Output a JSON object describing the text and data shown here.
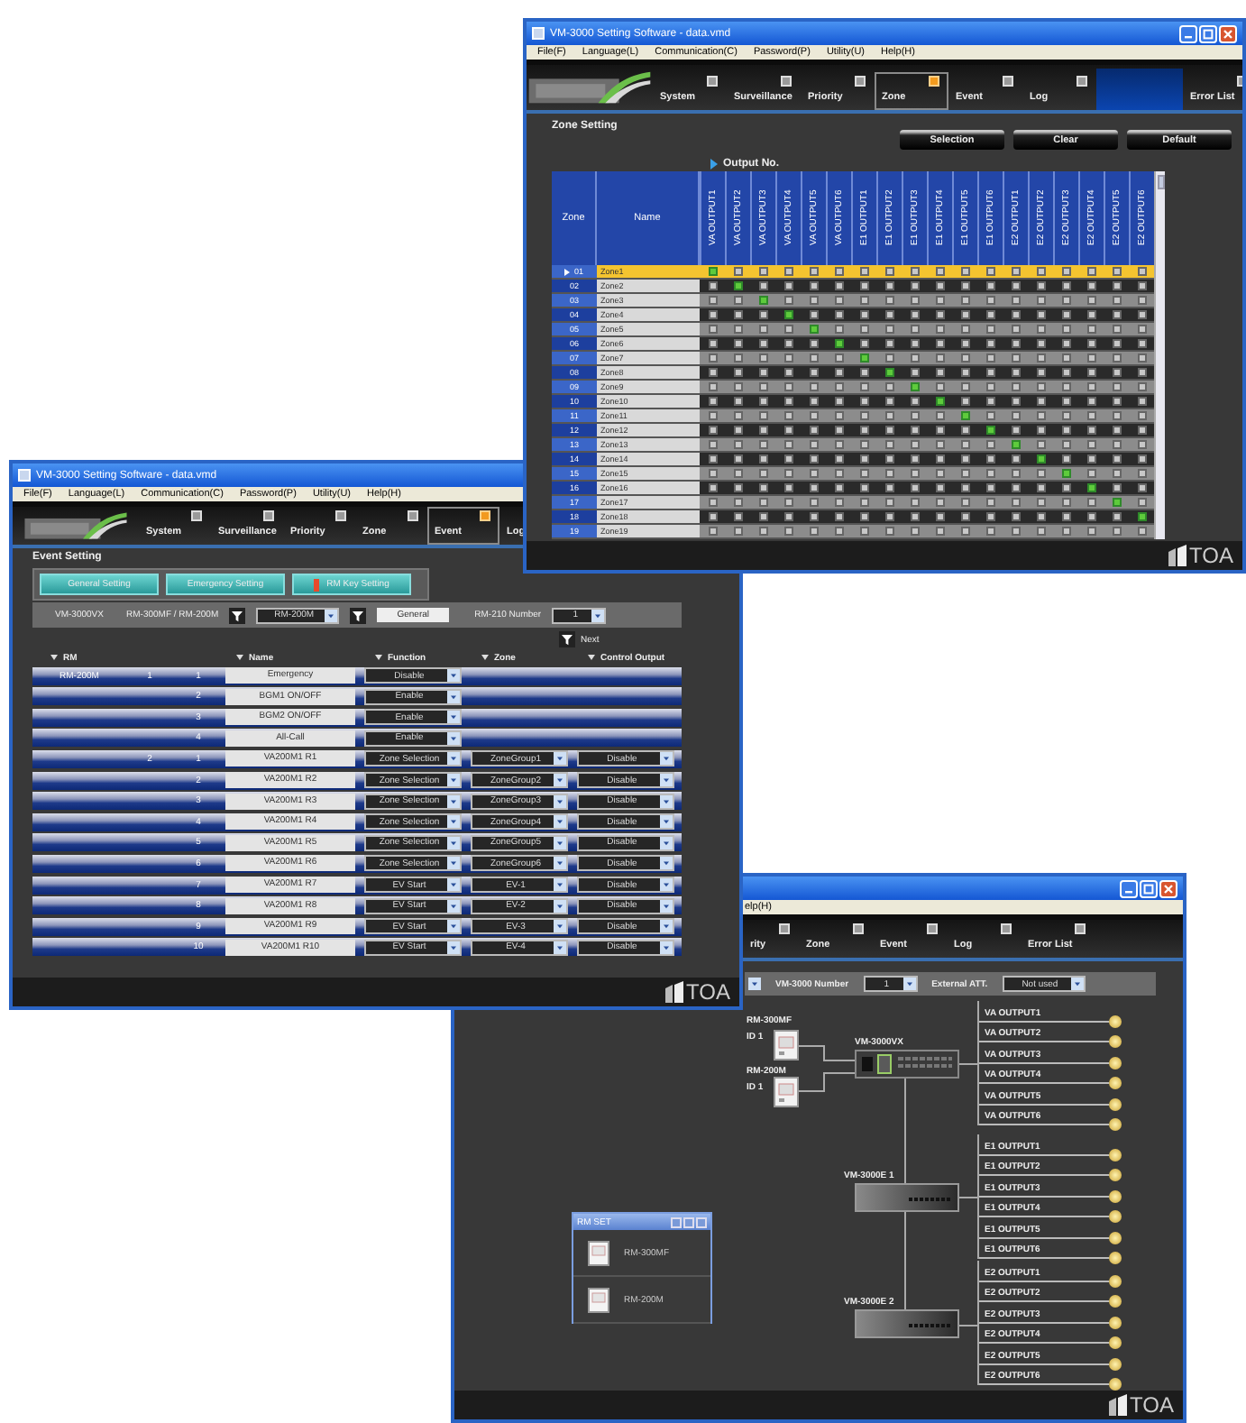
{
  "zone_window": {
    "title": "VM-3000 Setting Software - data.vmd",
    "menu": [
      "File(F)",
      "Language(L)",
      "Communication(C)",
      "Password(P)",
      "Utility(U)",
      "Help(H)"
    ],
    "tabs": [
      {
        "label": "System",
        "selected": false
      },
      {
        "label": "Surveillance",
        "selected": false
      },
      {
        "label": "Priority",
        "selected": false
      },
      {
        "label": "Zone",
        "selected": true
      },
      {
        "label": "Event",
        "selected": false
      },
      {
        "label": "Log",
        "selected": false
      },
      {
        "label": "Error List",
        "selected": false
      }
    ],
    "heading": "Zone Setting",
    "buttons": [
      "Selection",
      "Clear",
      "Default"
    ],
    "output_label": "Output No.",
    "columns": [
      "Zone",
      "Name"
    ],
    "outputs": [
      "VA OUTPUT1",
      "VA OUTPUT2",
      "VA OUTPUT3",
      "VA OUTPUT4",
      "VA OUTPUT5",
      "VA OUTPUT6",
      "E1 OUTPUT1",
      "E1 OUTPUT2",
      "E1 OUTPUT3",
      "E1 OUTPUT4",
      "E1 OUTPUT5",
      "E1 OUTPUT6",
      "E2 OUTPUT1",
      "E2 OUTPUT2",
      "E2 OUTPUT3",
      "E2 OUTPUT4",
      "E2 OUTPUT5",
      "E2 OUTPUT6"
    ],
    "rows": [
      {
        "zone": "01",
        "name": "Zone1",
        "selected": true,
        "outputs": [
          true,
          false,
          false,
          false,
          false,
          false,
          false,
          false,
          false,
          false,
          false,
          false,
          false,
          false,
          false,
          false,
          false,
          false
        ]
      },
      {
        "zone": "02",
        "name": "Zone2",
        "selected": false,
        "outputs": [
          false,
          true,
          false,
          false,
          false,
          false,
          false,
          false,
          false,
          false,
          false,
          false,
          false,
          false,
          false,
          false,
          false,
          false
        ]
      },
      {
        "zone": "03",
        "name": "Zone3",
        "selected": false,
        "outputs": [
          false,
          false,
          true,
          false,
          false,
          false,
          false,
          false,
          false,
          false,
          false,
          false,
          false,
          false,
          false,
          false,
          false,
          false
        ]
      },
      {
        "zone": "04",
        "name": "Zone4",
        "selected": false,
        "outputs": [
          false,
          false,
          false,
          true,
          false,
          false,
          false,
          false,
          false,
          false,
          false,
          false,
          false,
          false,
          false,
          false,
          false,
          false
        ]
      },
      {
        "zone": "05",
        "name": "Zone5",
        "selected": false,
        "outputs": [
          false,
          false,
          false,
          false,
          true,
          false,
          false,
          false,
          false,
          false,
          false,
          false,
          false,
          false,
          false,
          false,
          false,
          false
        ]
      },
      {
        "zone": "06",
        "name": "Zone6",
        "selected": false,
        "outputs": [
          false,
          false,
          false,
          false,
          false,
          true,
          false,
          false,
          false,
          false,
          false,
          false,
          false,
          false,
          false,
          false,
          false,
          false
        ]
      },
      {
        "zone": "07",
        "name": "Zone7",
        "selected": false,
        "outputs": [
          false,
          false,
          false,
          false,
          false,
          false,
          true,
          false,
          false,
          false,
          false,
          false,
          false,
          false,
          false,
          false,
          false,
          false
        ]
      },
      {
        "zone": "08",
        "name": "Zone8",
        "selected": false,
        "outputs": [
          false,
          false,
          false,
          false,
          false,
          false,
          false,
          true,
          false,
          false,
          false,
          false,
          false,
          false,
          false,
          false,
          false,
          false
        ]
      },
      {
        "zone": "09",
        "name": "Zone9",
        "selected": false,
        "outputs": [
          false,
          false,
          false,
          false,
          false,
          false,
          false,
          false,
          true,
          false,
          false,
          false,
          false,
          false,
          false,
          false,
          false,
          false
        ]
      },
      {
        "zone": "10",
        "name": "Zone10",
        "selected": false,
        "outputs": [
          false,
          false,
          false,
          false,
          false,
          false,
          false,
          false,
          false,
          true,
          false,
          false,
          false,
          false,
          false,
          false,
          false,
          false
        ]
      },
      {
        "zone": "11",
        "name": "Zone11",
        "selected": false,
        "outputs": [
          false,
          false,
          false,
          false,
          false,
          false,
          false,
          false,
          false,
          false,
          true,
          false,
          false,
          false,
          false,
          false,
          false,
          false
        ]
      },
      {
        "zone": "12",
        "name": "Zone12",
        "selected": false,
        "outputs": [
          false,
          false,
          false,
          false,
          false,
          false,
          false,
          false,
          false,
          false,
          false,
          true,
          false,
          false,
          false,
          false,
          false,
          false
        ]
      },
      {
        "zone": "13",
        "name": "Zone13",
        "selected": false,
        "outputs": [
          false,
          false,
          false,
          false,
          false,
          false,
          false,
          false,
          false,
          false,
          false,
          false,
          true,
          false,
          false,
          false,
          false,
          false
        ]
      },
      {
        "zone": "14",
        "name": "Zone14",
        "selected": false,
        "outputs": [
          false,
          false,
          false,
          false,
          false,
          false,
          false,
          false,
          false,
          false,
          false,
          false,
          false,
          true,
          false,
          false,
          false,
          false
        ]
      },
      {
        "zone": "15",
        "name": "Zone15",
        "selected": false,
        "outputs": [
          false,
          false,
          false,
          false,
          false,
          false,
          false,
          false,
          false,
          false,
          false,
          false,
          false,
          false,
          true,
          false,
          false,
          false
        ]
      },
      {
        "zone": "16",
        "name": "Zone16",
        "selected": false,
        "outputs": [
          false,
          false,
          false,
          false,
          false,
          false,
          false,
          false,
          false,
          false,
          false,
          false,
          false,
          false,
          false,
          true,
          false,
          false
        ]
      },
      {
        "zone": "17",
        "name": "Zone17",
        "selected": false,
        "outputs": [
          false,
          false,
          false,
          false,
          false,
          false,
          false,
          false,
          false,
          false,
          false,
          false,
          false,
          false,
          false,
          false,
          true,
          false
        ]
      },
      {
        "zone": "18",
        "name": "Zone18",
        "selected": false,
        "outputs": [
          false,
          false,
          false,
          false,
          false,
          false,
          false,
          false,
          false,
          false,
          false,
          false,
          false,
          false,
          false,
          false,
          false,
          true
        ]
      },
      {
        "zone": "19",
        "name": "Zone19",
        "selected": false,
        "outputs": [
          false,
          false,
          false,
          false,
          false,
          false,
          false,
          false,
          false,
          false,
          false,
          false,
          false,
          false,
          false,
          false,
          false,
          false
        ]
      }
    ],
    "brand": "TOA"
  },
  "event_window": {
    "title": "VM-3000 Setting Software - data.vmd",
    "menu": [
      "File(F)",
      "Language(L)",
      "Communication(C)",
      "Password(P)",
      "Utility(U)",
      "Help(H)"
    ],
    "tabs": [
      {
        "label": "System",
        "selected": false
      },
      {
        "label": "Surveillance",
        "selected": false
      },
      {
        "label": "Priority",
        "selected": false
      },
      {
        "label": "Zone",
        "selected": false
      },
      {
        "label": "Event",
        "selected": true
      },
      {
        "label": "Log",
        "selected": false
      }
    ],
    "heading": "Event Setting",
    "setting_buttons": [
      {
        "label": "General Setting",
        "selected": false
      },
      {
        "label": "Emergency Setting",
        "selected": false
      },
      {
        "label": "RM Key Setting",
        "selected": true
      }
    ],
    "filter": {
      "unit": "VM-3000VX",
      "device": "RM-300MF / RM-200M",
      "device_select": "RM-200M",
      "mode": "General",
      "number_label": "RM-210 Number",
      "number_select": "1"
    },
    "next": "Next",
    "columns": [
      "RM",
      "Name",
      "Function",
      "Zone",
      "Control Output"
    ],
    "rows": [
      {
        "rm": "RM-200M",
        "unit": "1",
        "key": "1",
        "name": "Emergency",
        "function": "Disable"
      },
      {
        "key": "2",
        "name": "BGM1 ON/OFF",
        "function": "Enable"
      },
      {
        "key": "3",
        "name": "BGM2 ON/OFF",
        "function": "Enable"
      },
      {
        "key": "4",
        "name": "All-Call",
        "function": "Enable"
      },
      {
        "unit": "2",
        "key": "1",
        "name": "VA200M1 R1",
        "function": "Zone Selection",
        "zone": "ZoneGroup1",
        "control_output": "Disable"
      },
      {
        "key": "2",
        "name": "VA200M1 R2",
        "function": "Zone Selection",
        "zone": "ZoneGroup2",
        "control_output": "Disable"
      },
      {
        "key": "3",
        "name": "VA200M1 R3",
        "function": "Zone Selection",
        "zone": "ZoneGroup3",
        "control_output": "Disable"
      },
      {
        "key": "4",
        "name": "VA200M1 R4",
        "function": "Zone Selection",
        "zone": "ZoneGroup4",
        "control_output": "Disable"
      },
      {
        "key": "5",
        "name": "VA200M1 R5",
        "function": "Zone Selection",
        "zone": "ZoneGroup5",
        "control_output": "Disable"
      },
      {
        "key": "6",
        "name": "VA200M1 R6",
        "function": "Zone Selection",
        "zone": "ZoneGroup6",
        "control_output": "Disable"
      },
      {
        "key": "7",
        "name": "VA200M1 R7",
        "function": "EV Start",
        "zone": "EV-1",
        "control_output": "Disable"
      },
      {
        "key": "8",
        "name": "VA200M1 R8",
        "function": "EV Start",
        "zone": "EV-2",
        "control_output": "Disable"
      },
      {
        "key": "9",
        "name": "VA200M1 R9",
        "function": "EV Start",
        "zone": "EV-3",
        "control_output": "Disable"
      },
      {
        "key": "10",
        "name": "VA200M1 R10",
        "function": "EV Start",
        "zone": "EV-4",
        "control_output": "Disable"
      }
    ],
    "brand": "TOA"
  },
  "system_window": {
    "menu": [
      "elp(H)"
    ],
    "tabs": [
      {
        "label": "rity",
        "selected": false
      },
      {
        "label": "Zone",
        "selected": false
      },
      {
        "label": "Event",
        "selected": false
      },
      {
        "label": "Log",
        "selected": false
      },
      {
        "label": "Error List",
        "selected": false
      }
    ],
    "toolbar": {
      "number_label": "VM-3000 Number",
      "number_select": "1",
      "att_label": "External ATT.",
      "att_select": "Not used"
    },
    "diagram": {
      "remotes": [
        {
          "model": "RM-300MF",
          "id": "ID 1"
        },
        {
          "model": "RM-200M",
          "id": "ID 1"
        }
      ],
      "main_unit": "VM-3000VX",
      "extensions": [
        "VM-3000E 1",
        "VM-3000E 2"
      ],
      "output_groups": [
        {
          "outputs": [
            "VA OUTPUT1",
            "VA OUTPUT2",
            "VA OUTPUT3",
            "VA OUTPUT4",
            "VA OUTPUT5",
            "VA OUTPUT6"
          ]
        },
        {
          "outputs": [
            "E1 OUTPUT1",
            "E1 OUTPUT2",
            "E1 OUTPUT3",
            "E1 OUTPUT4",
            "E1 OUTPUT5",
            "E1 OUTPUT6"
          ]
        },
        {
          "outputs": [
            "E2 OUTPUT1",
            "E2 OUTPUT2",
            "E2 OUTPUT3",
            "E2 OUTPUT4",
            "E2 OUTPUT5",
            "E2 OUTPUT6"
          ]
        }
      ]
    },
    "palette": {
      "title": "RM SET",
      "items": [
        "RM-300MF",
        "RM-200M"
      ]
    },
    "brand": "TOA"
  }
}
